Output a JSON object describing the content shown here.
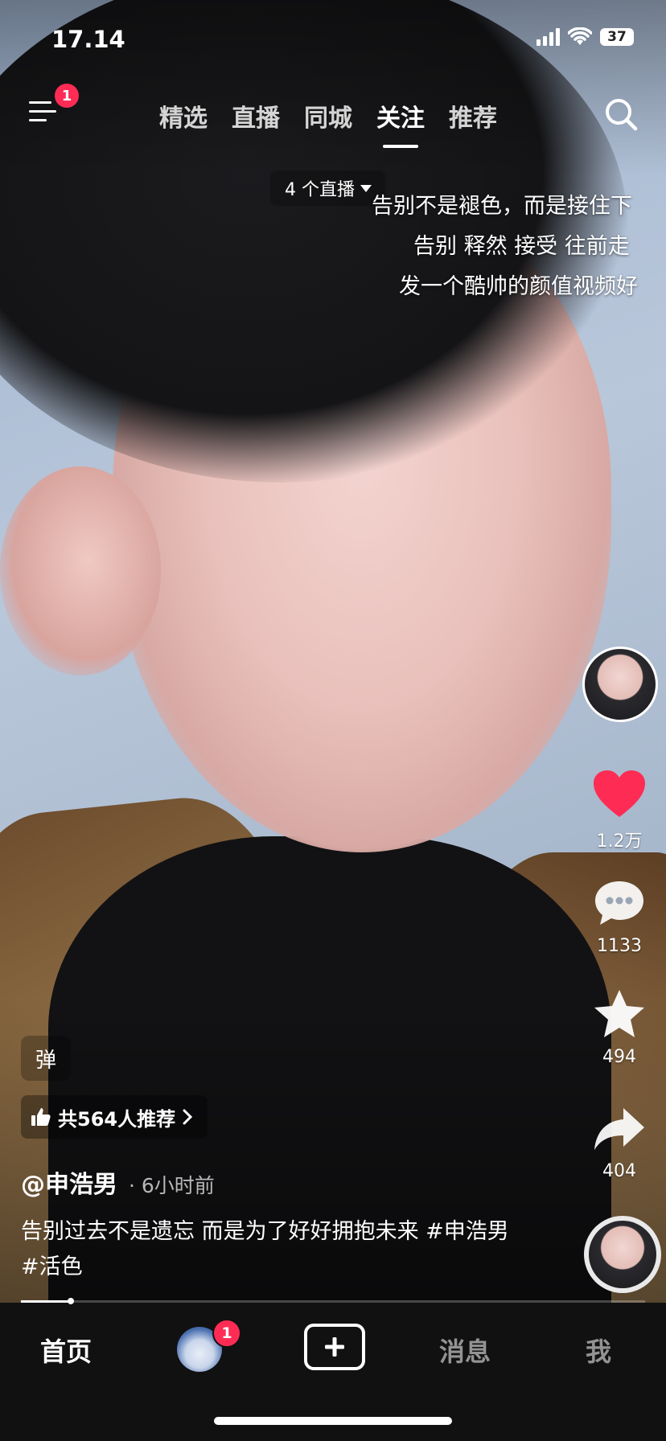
{
  "status_bar": {
    "time": "17.14",
    "battery": "37"
  },
  "top_nav": {
    "menu_badge": "1",
    "tabs": [
      {
        "label": "精选",
        "active": false
      },
      {
        "label": "直播",
        "active": false
      },
      {
        "label": "同城",
        "active": false
      },
      {
        "label": "关注",
        "active": true
      },
      {
        "label": "推荐",
        "active": false
      }
    ]
  },
  "live_pill": {
    "label": "4 个直播",
    "icon": "caret-down-icon"
  },
  "danmaku": [
    "告别不是褪色，而是接住下",
    "告别 释然 接受 往前走",
    "发一个酷帅的颜值视频好"
  ],
  "rail": {
    "like_count": "1.2万",
    "comment_count": "1133",
    "favorite_count": "494",
    "share_count": "404",
    "colors": {
      "like": "#fe2c55",
      "badge": "#fe2c55"
    }
  },
  "video": {
    "danmaku_toggle": "弹",
    "recommend_label": "共564人推荐",
    "author": "@申浩男",
    "time_ago": "6小时前",
    "caption": "告别过去不是遗忘 而是为了好好拥抱未来 #申浩男 #活色",
    "progress": 0.08
  },
  "bottom_nav": {
    "home": "首页",
    "friends_badge": "1",
    "messages": "消息",
    "me": "我"
  }
}
